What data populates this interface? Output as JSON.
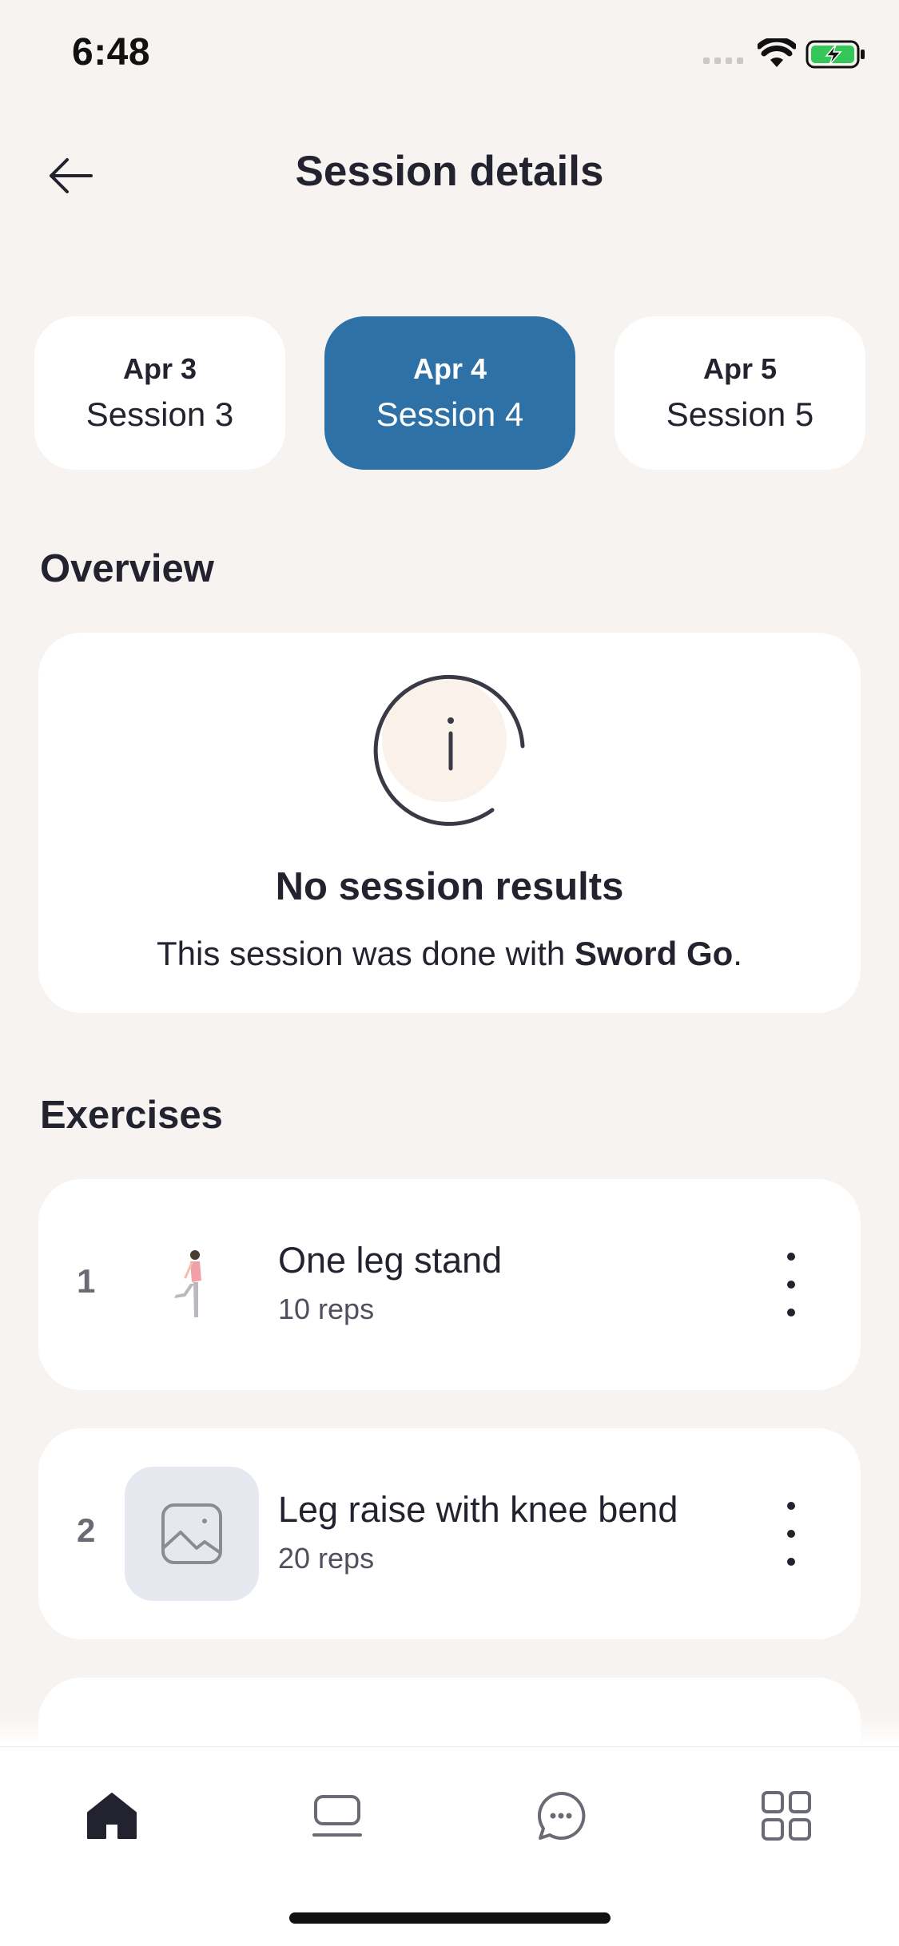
{
  "status_bar": {
    "time": "6:48"
  },
  "header": {
    "title": "Session details",
    "back_icon": "arrow-left-icon"
  },
  "sessions": [
    {
      "date": "Apr 3",
      "name": "Session 3",
      "active": false
    },
    {
      "date": "Apr 4",
      "name": "Session 4",
      "active": true
    },
    {
      "date": "Apr 5",
      "name": "Session 5",
      "active": false
    }
  ],
  "overview": {
    "title": "Overview",
    "result_title": "No session results",
    "message_prefix": "This session was done with ",
    "message_bold": "Sword Go",
    "message_suffix": "."
  },
  "exercises": {
    "title": "Exercises",
    "items": [
      {
        "index": "1",
        "name": "One leg stand",
        "reps": "10 reps",
        "thumb": "figure-one-leg-stand"
      },
      {
        "index": "2",
        "name": "Leg raise with knee bend",
        "reps": "20 reps",
        "thumb": "image-placeholder-icon"
      }
    ]
  },
  "nav": [
    "home-icon",
    "sessions-icon",
    "chat-icon",
    "grid-icon"
  ],
  "colors": {
    "accent": "#2d71a7",
    "background": "#f6f3f0",
    "card": "#ffffff",
    "text": "#23232f",
    "battery": "#35c759"
  }
}
